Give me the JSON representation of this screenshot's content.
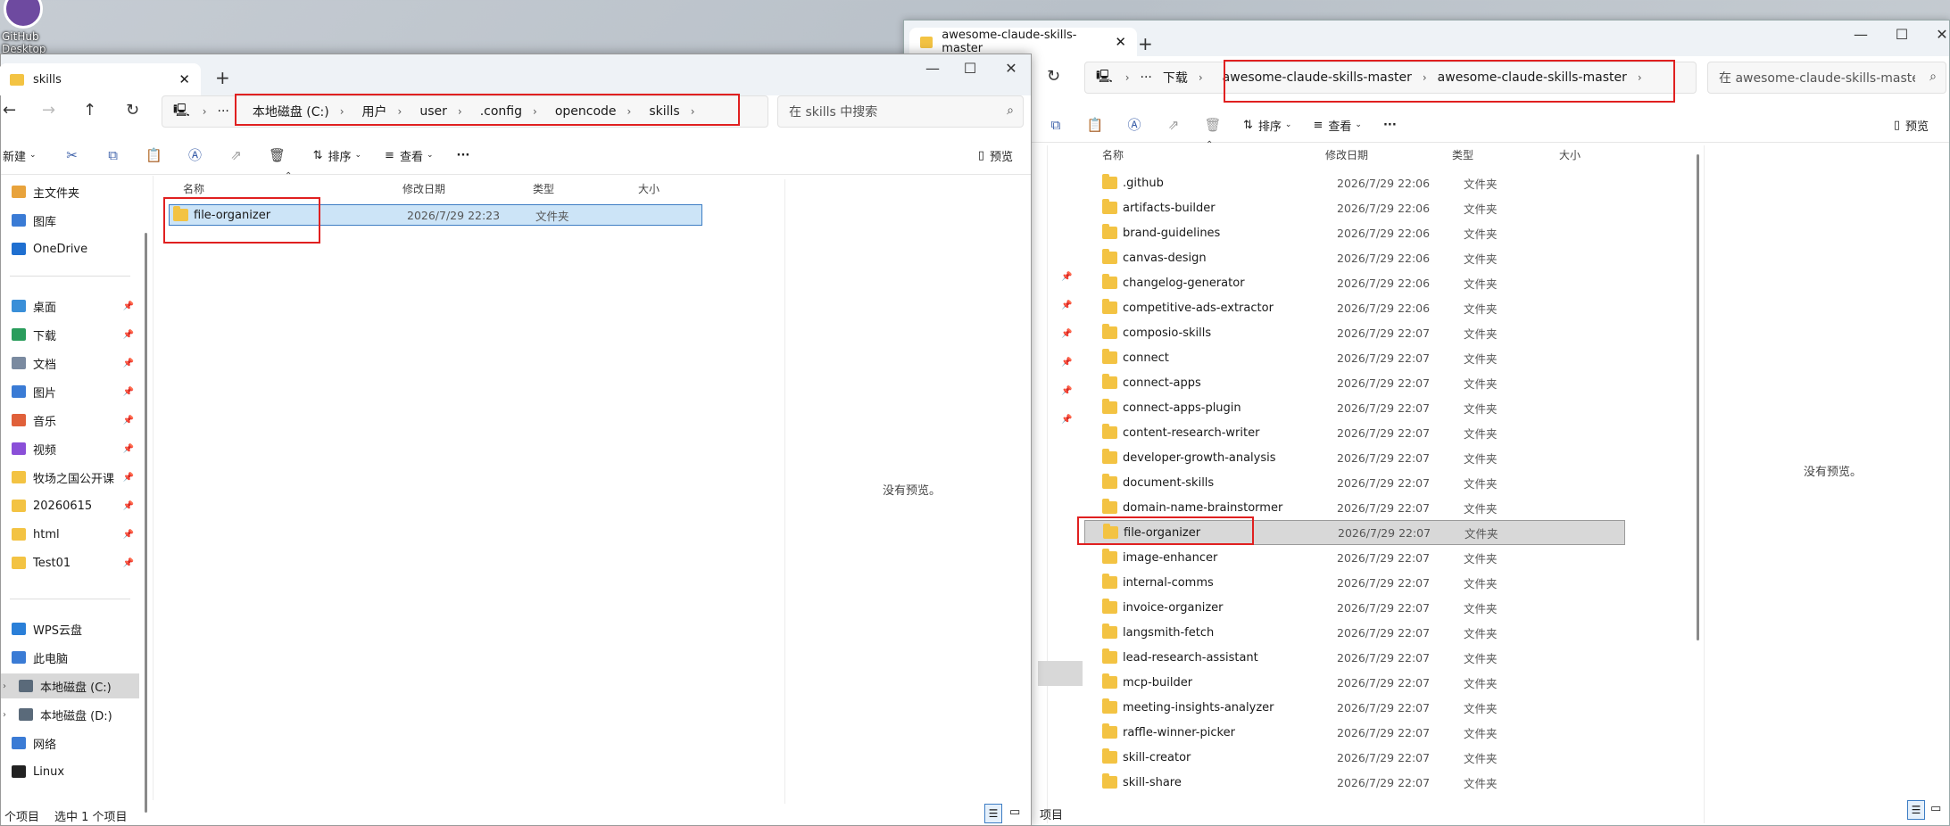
{
  "desktop": {
    "icon_label": "GitHub Desktop"
  },
  "right_window": {
    "tab_title": "awesome-claude-skills-master",
    "breadcrumbs": [
      "下载",
      "awesome-claude-skills-master",
      "awesome-claude-skills-master"
    ],
    "search_placeholder": "在 awesome-claude-skills-master 中",
    "toolbar": {
      "sort": "排序",
      "view": "查看",
      "more": "···",
      "preview": "预览"
    },
    "columns": {
      "name": "名称",
      "date": "修改日期",
      "type": "类型",
      "size": "大小"
    },
    "no_preview": "没有预览。",
    "status_text": "项目",
    "selected_row": 14,
    "rows": [
      {
        "name": ".github",
        "date": "2026/7/29 22:06",
        "type": "文件夹"
      },
      {
        "name": "artifacts-builder",
        "date": "2026/7/29 22:06",
        "type": "文件夹"
      },
      {
        "name": "brand-guidelines",
        "date": "2026/7/29 22:06",
        "type": "文件夹"
      },
      {
        "name": "canvas-design",
        "date": "2026/7/29 22:06",
        "type": "文件夹"
      },
      {
        "name": "changelog-generator",
        "date": "2026/7/29 22:06",
        "type": "文件夹"
      },
      {
        "name": "competitive-ads-extractor",
        "date": "2026/7/29 22:06",
        "type": "文件夹"
      },
      {
        "name": "composio-skills",
        "date": "2026/7/29 22:07",
        "type": "文件夹"
      },
      {
        "name": "connect",
        "date": "2026/7/29 22:07",
        "type": "文件夹"
      },
      {
        "name": "connect-apps",
        "date": "2026/7/29 22:07",
        "type": "文件夹"
      },
      {
        "name": "connect-apps-plugin",
        "date": "2026/7/29 22:07",
        "type": "文件夹"
      },
      {
        "name": "content-research-writer",
        "date": "2026/7/29 22:07",
        "type": "文件夹"
      },
      {
        "name": "developer-growth-analysis",
        "date": "2026/7/29 22:07",
        "type": "文件夹"
      },
      {
        "name": "document-skills",
        "date": "2026/7/29 22:07",
        "type": "文件夹"
      },
      {
        "name": "domain-name-brainstormer",
        "date": "2026/7/29 22:07",
        "type": "文件夹"
      },
      {
        "name": "file-organizer",
        "date": "2026/7/29 22:07",
        "type": "文件夹"
      },
      {
        "name": "image-enhancer",
        "date": "2026/7/29 22:07",
        "type": "文件夹"
      },
      {
        "name": "internal-comms",
        "date": "2026/7/29 22:07",
        "type": "文件夹"
      },
      {
        "name": "invoice-organizer",
        "date": "2026/7/29 22:07",
        "type": "文件夹"
      },
      {
        "name": "langsmith-fetch",
        "date": "2026/7/29 22:07",
        "type": "文件夹"
      },
      {
        "name": "lead-research-assistant",
        "date": "2026/7/29 22:07",
        "type": "文件夹"
      },
      {
        "name": "mcp-builder",
        "date": "2026/7/29 22:07",
        "type": "文件夹"
      },
      {
        "name": "meeting-insights-analyzer",
        "date": "2026/7/29 22:07",
        "type": "文件夹"
      },
      {
        "name": "raffle-winner-picker",
        "date": "2026/7/29 22:07",
        "type": "文件夹"
      },
      {
        "name": "skill-creator",
        "date": "2026/7/29 22:07",
        "type": "文件夹"
      },
      {
        "name": "skill-share",
        "date": "2026/7/29 22:07",
        "type": "文件夹"
      }
    ]
  },
  "left_window": {
    "tab_title": "skills",
    "breadcrumbs": [
      "本地磁盘 (C:)",
      "用户",
      "user",
      ".config",
      "opencode",
      "skills"
    ],
    "search_placeholder": "在 skills 中搜索",
    "toolbar": {
      "new": "新建",
      "sort": "排序",
      "view": "查看",
      "more": "···",
      "preview": "预览"
    },
    "columns": {
      "name": "名称",
      "date": "修改日期",
      "type": "类型",
      "size": "大小"
    },
    "rows": [
      {
        "name": "file-organizer",
        "date": "2026/7/29 22:23",
        "type": "文件夹"
      }
    ],
    "no_preview": "没有预览。",
    "sidebar": {
      "group1": [
        {
          "label": "主文件夹",
          "icon": "home-icon",
          "color": "#e8a33c"
        },
        {
          "label": "图库",
          "icon": "gallery-icon",
          "color": "#3a7bd5"
        },
        {
          "label": "OneDrive",
          "icon": "cloud-icon",
          "color": "#1f6fd0"
        }
      ],
      "group2": [
        {
          "label": "桌面",
          "icon": "desktop-icon",
          "color": "#3a8fd8"
        },
        {
          "label": "下载",
          "icon": "download-icon",
          "color": "#2a9d5c"
        },
        {
          "label": "文档",
          "icon": "document-icon",
          "color": "#7a8aa0"
        },
        {
          "label": "图片",
          "icon": "pictures-icon",
          "color": "#3a7bd5"
        },
        {
          "label": "音乐",
          "icon": "music-icon",
          "color": "#e0603a"
        },
        {
          "label": "视频",
          "icon": "video-icon",
          "color": "#8a4fd8"
        },
        {
          "label": "牧场之国公开课",
          "icon": "folder-icon",
          "color": "#f3c343"
        },
        {
          "label": "20260615",
          "icon": "folder-icon",
          "color": "#f3c343"
        },
        {
          "label": "html",
          "icon": "folder-icon",
          "color": "#f3c343"
        },
        {
          "label": "Test01",
          "icon": "folder-icon",
          "color": "#f3c343"
        }
      ],
      "group3": [
        {
          "label": "WPS云盘",
          "icon": "cloud-icon",
          "color": "#2a7fd8"
        },
        {
          "label": "此电脑",
          "icon": "computer-icon",
          "color": "#3a7bd5"
        },
        {
          "label": "本地磁盘 (C:)",
          "icon": "drive-icon",
          "color": "#5a6a7a"
        },
        {
          "label": "本地磁盘 (D:)",
          "icon": "drive-icon",
          "color": "#5a6a7a"
        },
        {
          "label": "网络",
          "icon": "network-icon",
          "color": "#3a7bd5"
        },
        {
          "label": "Linux",
          "icon": "linux-icon",
          "color": "#222222"
        }
      ]
    },
    "status": {
      "count": "个项目",
      "selected": "选中 1 个项目"
    }
  }
}
